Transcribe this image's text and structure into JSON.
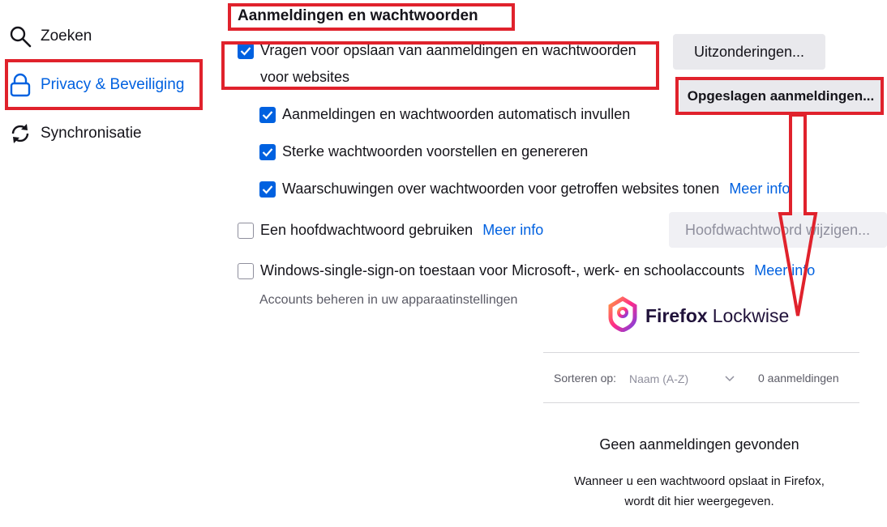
{
  "sidebar": {
    "items": [
      {
        "label": "Zoeken",
        "icon": "search-icon"
      },
      {
        "label": "Privacy & Beveiliging",
        "icon": "lock-icon"
      },
      {
        "label": "Synchronisatie",
        "icon": "sync-icon"
      }
    ]
  },
  "section": {
    "title": "Aanmeldingen en wachtwoorden"
  },
  "options": {
    "ask_save": {
      "line1": "Vragen voor opslaan van aanmeldingen en wachtwoorden",
      "line2": "voor websites",
      "checked": true
    },
    "autofill": {
      "label": "Aanmeldingen en wachtwoorden automatisch invullen",
      "checked": true
    },
    "suggest": {
      "label": "Sterke wachtwoorden voorstellen en genereren",
      "checked": true
    },
    "warnings": {
      "label": "Waarschuwingen over wachtwoorden voor getroffen websites tonen",
      "link": "Meer info",
      "checked": true
    },
    "master": {
      "label": "Een hoofdwachtwoord gebruiken",
      "link": "Meer info",
      "checked": false
    },
    "sso": {
      "label": "Windows-single-sign-on toestaan voor Microsoft-, werk- en schoolaccounts",
      "link": "Meer info",
      "checked": false
    },
    "sso_hint": "Accounts beheren in uw apparaatinstellingen"
  },
  "buttons": {
    "exceptions": "Uitzonderingen...",
    "saved_logins": "Opgeslagen aanmeldingen...",
    "change_master": "Hoofdwachtwoord wijzigen..."
  },
  "lockwise": {
    "brand_a": "Firefox",
    "brand_b": "Lockwise",
    "sort_label": "Sorteren op:",
    "sort_value": "Naam (A-Z)",
    "count": "0 aanmeldingen",
    "empty_title": "Geen aanmeldingen gevonden",
    "empty_line1": "Wanneer u een wachtwoord opslaat in Firefox,",
    "empty_line2": "wordt dit hier weergegeven."
  },
  "colors": {
    "accent": "#0061e0",
    "annotation": "#e0222c"
  }
}
